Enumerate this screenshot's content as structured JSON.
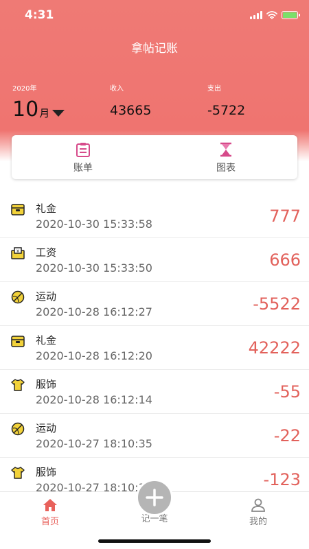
{
  "status_bar": {
    "time": "4:31"
  },
  "header": {
    "app_title": "拿帖记账",
    "year_label": "2020年",
    "month_number": "10",
    "month_suffix": "月",
    "income_label": "收入",
    "income_value": "43665",
    "expense_label": "支出",
    "expense_value": "-5722"
  },
  "tabs": [
    {
      "label": "账单",
      "icon": "bill-icon"
    },
    {
      "label": "图表",
      "icon": "hourglass-icon"
    }
  ],
  "transactions": [
    {
      "category": "礼金",
      "time": "2020-10-30 15:33:58",
      "amount": "777",
      "icon": "gift-box-icon"
    },
    {
      "category": "工资",
      "time": "2020-10-30 15:33:50",
      "amount": "666",
      "icon": "salary-icon"
    },
    {
      "category": "运动",
      "time": "2020-10-28 16:12:27",
      "amount": "-5522",
      "icon": "sport-ball-icon"
    },
    {
      "category": "礼金",
      "time": "2020-10-28 16:12:20",
      "amount": "42222",
      "icon": "gift-box-icon"
    },
    {
      "category": "服饰",
      "time": "2020-10-28 16:12:14",
      "amount": "-55",
      "icon": "tshirt-icon"
    },
    {
      "category": "运动",
      "time": "2020-10-27 18:10:35",
      "amount": "-22",
      "icon": "sport-ball-icon"
    },
    {
      "category": "服饰",
      "time": "2020-10-27 18:10:35",
      "amount": "-123",
      "icon": "tshirt-icon"
    }
  ],
  "tabbar": {
    "home_label": "首页",
    "add_label": "记一笔",
    "mine_label": "我的"
  },
  "colors": {
    "header_bg": "#ef7470",
    "accent": "#e8615b",
    "amount": "#e2615b",
    "icon_yellow": "#f2d23a",
    "icon_pink": "#d64a8a"
  }
}
